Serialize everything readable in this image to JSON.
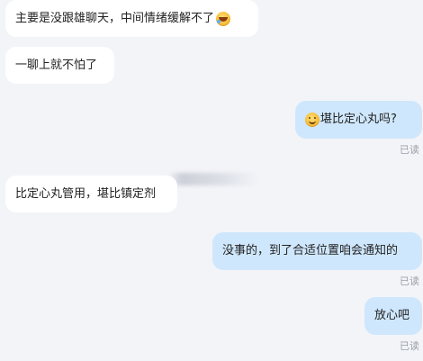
{
  "conversation": {
    "messages": [
      {
        "side": "left",
        "text": "主要是没跟雄聊天，中间情绪缓解不了",
        "emoji": "laughing-tears-icon"
      },
      {
        "side": "left",
        "text": "一聊上就不怕了"
      },
      {
        "side": "right",
        "text": "堪比定心丸吗?",
        "emoji_leading": "smile-icon",
        "read": "已读"
      },
      {
        "side": "left",
        "text": "比定心丸管用，堪比镇定剂"
      },
      {
        "side": "right",
        "text": "没事的，到了合适位置咱会通知的",
        "read": "已读"
      },
      {
        "side": "right",
        "text": "放心吧",
        "read": "已读"
      }
    ]
  },
  "colors": {
    "background": "#f3f4f8",
    "left_bubble": "#ffffff",
    "right_bubble": "#cfe7fc",
    "read_text": "#9aa0a8"
  }
}
